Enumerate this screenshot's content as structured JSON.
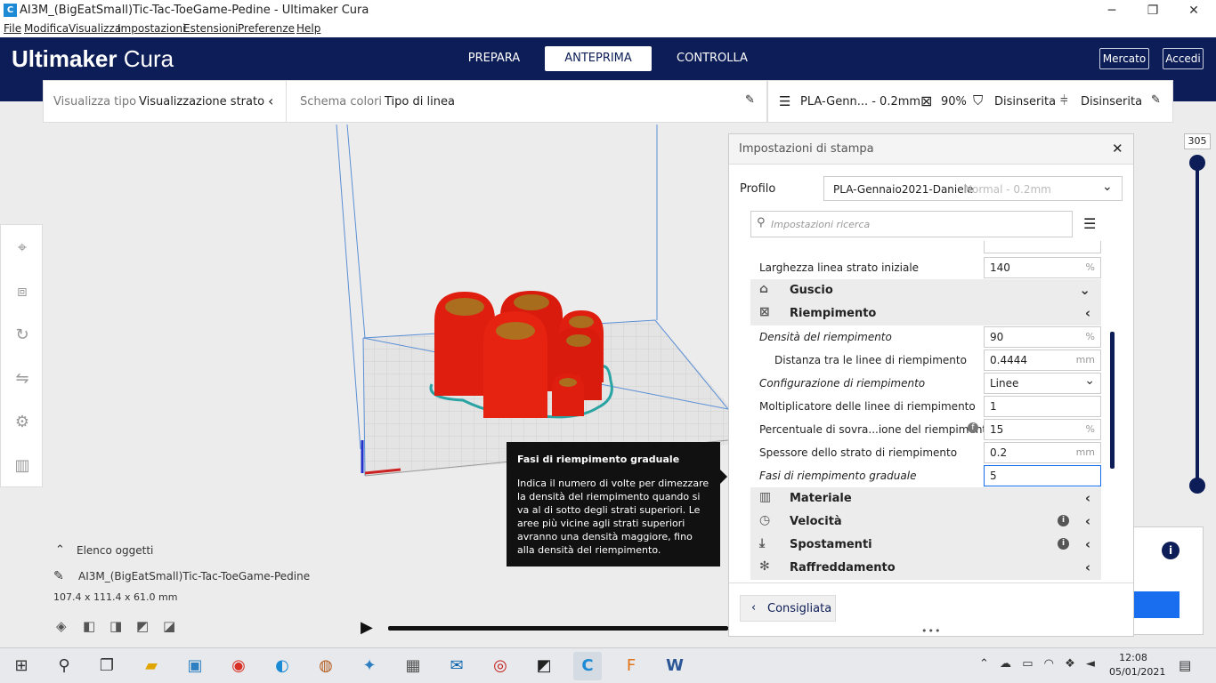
{
  "window": {
    "title": "AI3M_(BigEatSmall)Tic-Tac-ToeGame-Pedine - Ultimaker Cura",
    "minimize": "─",
    "restore": "❐",
    "close": "✕"
  },
  "menu": [
    "File",
    "Modifica",
    "Visualizza",
    "Impostazioni",
    "Estensioni",
    "Preferenze",
    "Help"
  ],
  "header": {
    "logo_bold": "Ultimaker",
    "logo_light": "Cura",
    "stages": [
      "PREPARA",
      "ANTEPRIMA",
      "CONTROLLA"
    ],
    "active_stage": "ANTEPRIMA",
    "marketplace": "Mercato",
    "signin": "Accedi"
  },
  "viewbar": {
    "view_label": "Visualizza tipo",
    "view_value": "Visualizzazione strato",
    "color_label": "Schema colori",
    "color_value": "Tipo di linea"
  },
  "printbar": {
    "profile": "PLA-Genn... - 0.2mm",
    "infill": "90%",
    "support": "Disinserita",
    "adhesion": "Disinserita"
  },
  "layer_slider": {
    "top_value": "305"
  },
  "objects": {
    "toggle": "Elenco oggetti",
    "name": "AI3M_(BigEatSmall)Tic-Tac-ToeGame-Pedine",
    "dims": "107.4 x 111.4 x 61.0 mm"
  },
  "panel": {
    "title": "Impostazioni di stampa",
    "profile_label": "Profilo",
    "profile_name": "PLA-Gennaio2021-Daniele",
    "profile_detail": "Normal - 0.2mm",
    "search_placeholder": "Impostazioni ricerca",
    "rows_top": [
      {
        "label": "Larghezza linea strato iniziale",
        "value": "140",
        "unit": "%"
      }
    ],
    "categories_top": [
      {
        "icon": "guscio",
        "label": "Guscio",
        "chev": "⌄"
      },
      {
        "icon": "riempimento",
        "label": "Riempimento",
        "chev": "‹"
      }
    ],
    "infill_rows": [
      {
        "label": "Densità del riempimento",
        "value": "90",
        "unit": "%",
        "italic": true
      },
      {
        "label": "Distanza tra le linee di riempimento",
        "value": "0.4444",
        "unit": "mm",
        "indent": true
      },
      {
        "label": "Configurazione di riempimento",
        "value": "Linee",
        "unit": "⌄",
        "italic": true
      },
      {
        "label": "Moltiplicatore delle linee di riempimento",
        "value": "1",
        "unit": ""
      },
      {
        "label": "Percentuale di sovra...ione del riempimento",
        "value": "15",
        "unit": "%"
      },
      {
        "label": "Spessore dello strato di riempimento",
        "value": "0.2",
        "unit": "mm"
      },
      {
        "label": "Fasi di riempimento graduale",
        "value": "5",
        "unit": "",
        "italic": true
      }
    ],
    "categories_bottom": [
      {
        "label": "Materiale",
        "info": ""
      },
      {
        "label": "Velocità",
        "info": "i"
      },
      {
        "label": "Spostamenti",
        "info": "i"
      },
      {
        "label": "Raffreddamento",
        "info": ""
      }
    ],
    "recommended_button": "Consigliata"
  },
  "tooltip": {
    "title": "Fasi di riempimento graduale",
    "body": "Indica il numero di volte per dimezzare la densità del riempimento quando si va al di sotto degli strati superiori. Le aree più vicine agli strati superiori avranno una densità maggiore, fino alla densità del riempimento."
  },
  "taskbar": {
    "time": "12:08",
    "date": "05/01/2021"
  }
}
